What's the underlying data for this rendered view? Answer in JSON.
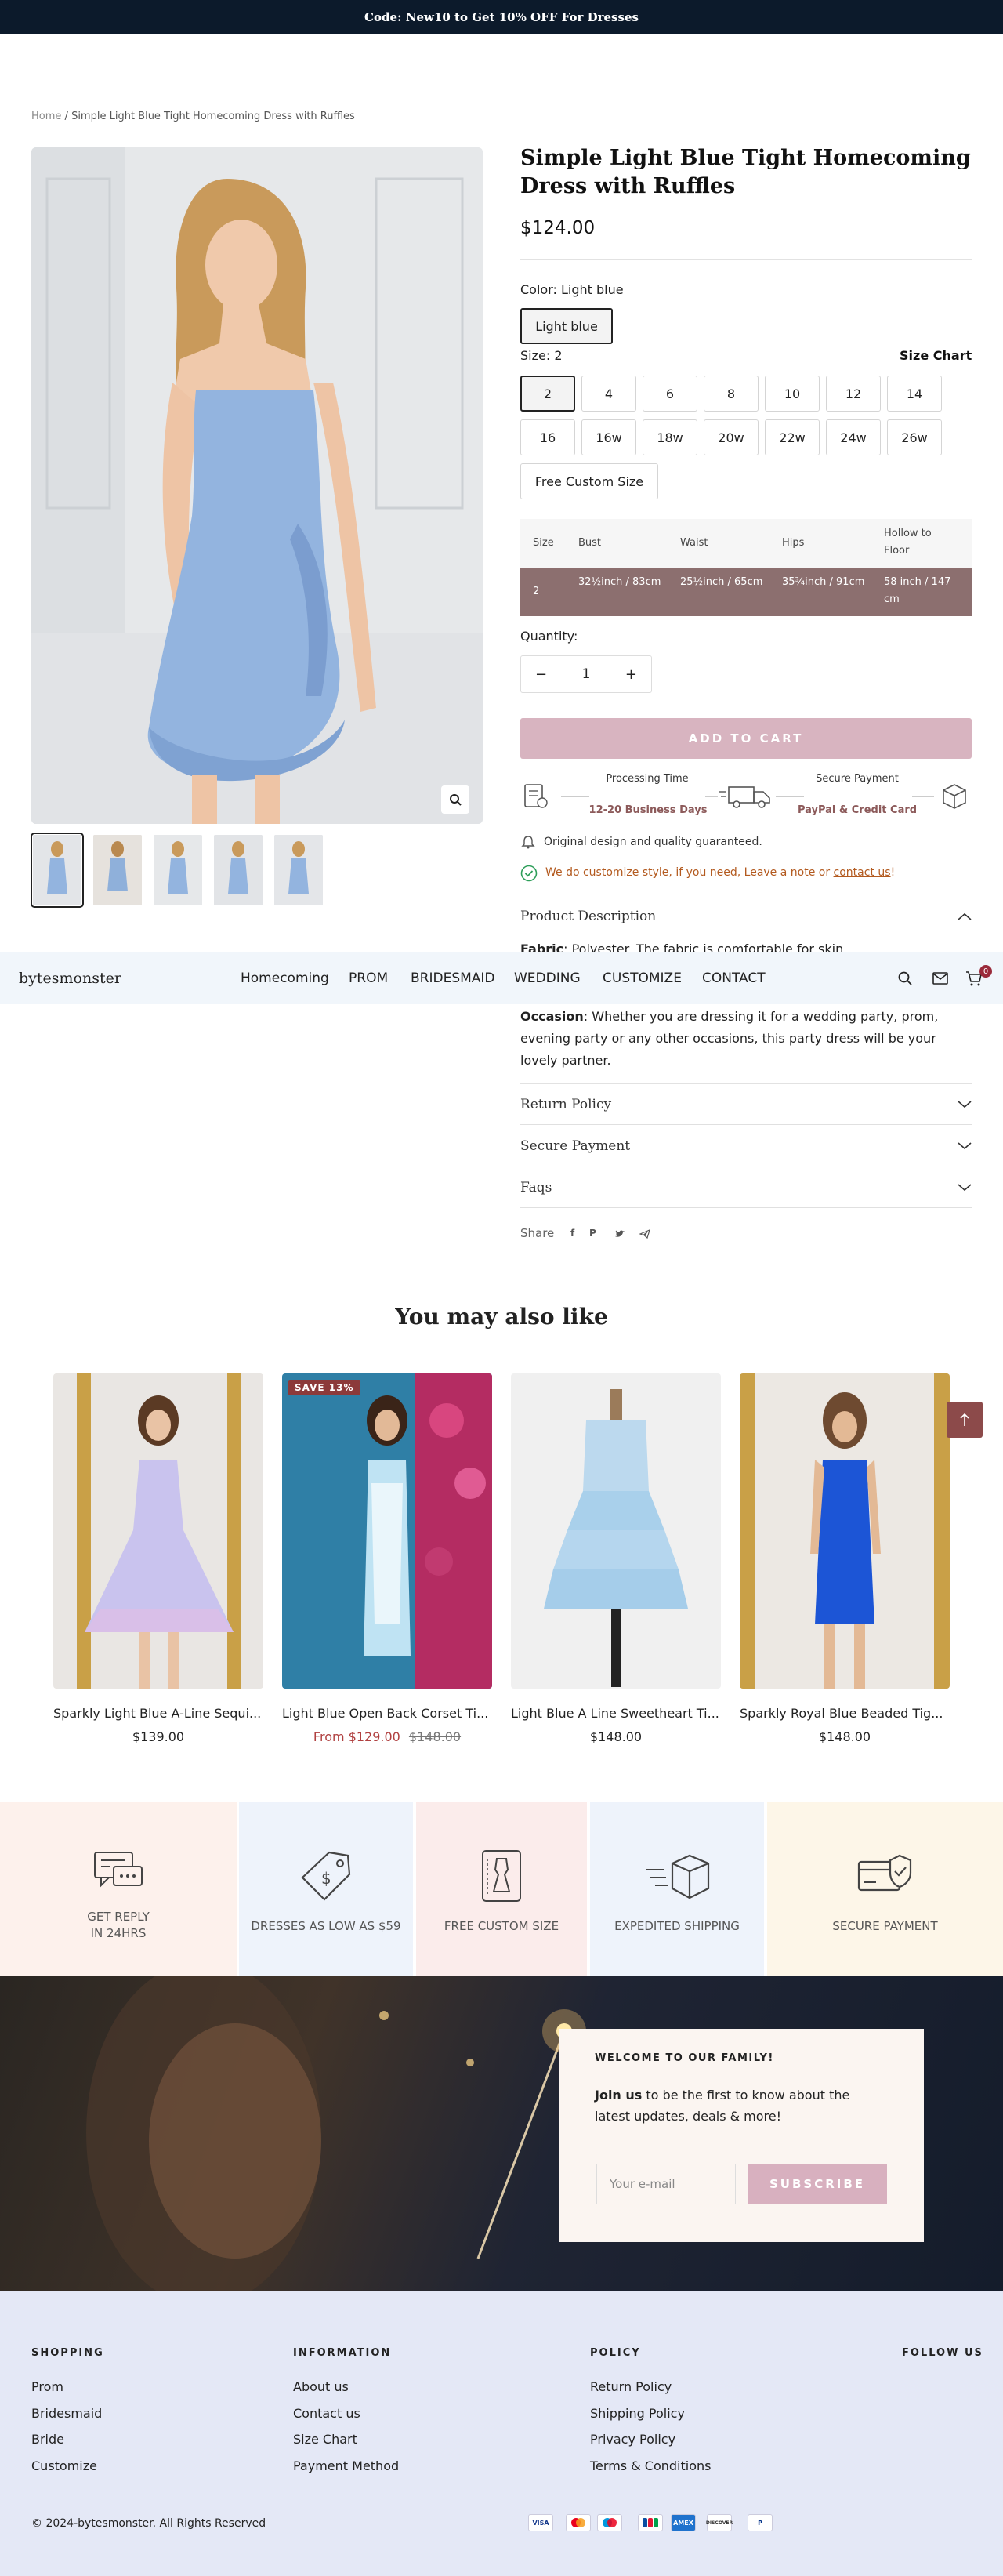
{
  "announcement": "Code: New10 to Get 10% OFF For Dresses",
  "breadcrumb": {
    "home": "Home",
    "separator": "/",
    "current": "Simple Light Blue Tight Homecoming Dress with Ruffles"
  },
  "product": {
    "title": "Simple Light Blue Tight Homecoming Dress with Ruffles",
    "price": "$124.00",
    "color_label": "Color:",
    "color_value": "Light blue",
    "color_option": "Light blue",
    "size_label": "Size:",
    "size_value": "2",
    "size_chart_link": "Size Chart",
    "sizes": [
      "2",
      "4",
      "6",
      "8",
      "10",
      "12",
      "14",
      "16",
      "16w",
      "18w",
      "20w",
      "22w",
      "24w",
      "26w",
      "Free Custom Size"
    ],
    "selected_size": "2",
    "size_table": {
      "headers": [
        "Size",
        "Bust",
        "Waist",
        "Hips",
        "Hollow to Floor"
      ],
      "row": [
        "2",
        "32½inch / 83cm",
        "25½inch / 65cm",
        "35¾inch / 91cm",
        "58 inch / 147 cm"
      ]
    },
    "quantity_label": "Quantity:",
    "quantity_value": "1",
    "add_to_cart": "ADD TO CART",
    "processing_time_label": "Processing Time",
    "processing_time_value": "12-20 Business Days",
    "secure_payment_label": "Secure Payment",
    "secure_payment_value": "PayPal & Credit Card",
    "guarantee_text": "Original design and quality guaranteed.",
    "customize_text": "We do customize style, if you need, Leave a note or",
    "customize_link": "contact us",
    "customize_suffix": "!",
    "description_title": "Product Description",
    "fabric_label": "Fabric",
    "fabric_text": ": Polyester. The fabric is comfortable for skin.",
    "occasion_label": "Occasion",
    "occasion_text": ": Whether you are dressing it for a wedding party, prom, evening party or any other occasions, this party dress will be your lovely partner.",
    "accordions": [
      "Return Policy",
      "Secure Payment",
      "Faqs"
    ],
    "share_label": "Share"
  },
  "nav": {
    "logo": "bytesmonster",
    "items": [
      "Homecoming",
      "PROM",
      "BRIDESMAID",
      "WEDDING",
      "CUSTOMIZE",
      "CONTACT"
    ],
    "cart_count": "0"
  },
  "recommendations": {
    "title": "You may also like",
    "items": [
      {
        "name": "Sparkly Light Blue A-Line Sequi...",
        "price": "$139.00"
      },
      {
        "name": "Light Blue Open Back Corset Ti...",
        "sale_price": "From $129.00",
        "compare_price": "$148.00",
        "badge": "SAVE 13%"
      },
      {
        "name": "Light Blue A Line Sweetheart Ti...",
        "price": "$148.00"
      },
      {
        "name": "Sparkly Royal Blue Beaded Tig...",
        "price": "$148.00"
      }
    ]
  },
  "features": [
    {
      "line1": "GET REPLY",
      "line2": "IN 24HRS",
      "icon": "chat-icon",
      "bg": "#fdf1ec"
    },
    {
      "line1": "DRESSES AS LOW AS $59",
      "line2": "",
      "icon": "price-tag-icon",
      "bg": "#eef3fb"
    },
    {
      "line1": "FREE CUSTOM SIZE",
      "line2": "",
      "icon": "dress-form-icon",
      "bg": "#fbeceb"
    },
    {
      "line1": "EXPEDITED SHIPPING",
      "line2": "",
      "icon": "shipping-box-icon",
      "bg": "#eef3fb"
    },
    {
      "line1": "SECURE PAYMENT",
      "line2": "",
      "icon": "secure-card-icon",
      "bg": "#fdf6e8"
    }
  ],
  "newsletter": {
    "heading": "WELCOME TO OUR FAMILY!",
    "bold": "Join us",
    "text": " to be the first to know about the latest updates, deals & more!",
    "placeholder": "Your e-mail",
    "button": "SUBSCRIBE"
  },
  "footer": {
    "shopping": {
      "title": "SHOPPING",
      "links": [
        "Prom",
        "Bridesmaid",
        "Bride",
        "Customize"
      ]
    },
    "information": {
      "title": "INFORMATION",
      "links": [
        "About us",
        "Contact us",
        "Size Chart",
        "Payment Method"
      ]
    },
    "policy": {
      "title": "POLICY",
      "links": [
        "Return Policy",
        "Shipping Policy",
        "Privacy Policy",
        "Terms & Conditions"
      ]
    },
    "follow": "FOLLOW US",
    "copyright": "© 2024-bytesmonster. All Rights Reserved",
    "payments": [
      "VISA",
      "MC",
      "MAESTRO",
      "JCB",
      "AMEX",
      "DISCOVER",
      "PAYPAL"
    ]
  },
  "colors": {
    "accent": "#8c5a5a",
    "cart_button": "#d8b4c0",
    "announcement_bg": "#0c1a2b",
    "nav_bg": "#f1f6fb",
    "footer_bg": "#e4e8f6"
  }
}
